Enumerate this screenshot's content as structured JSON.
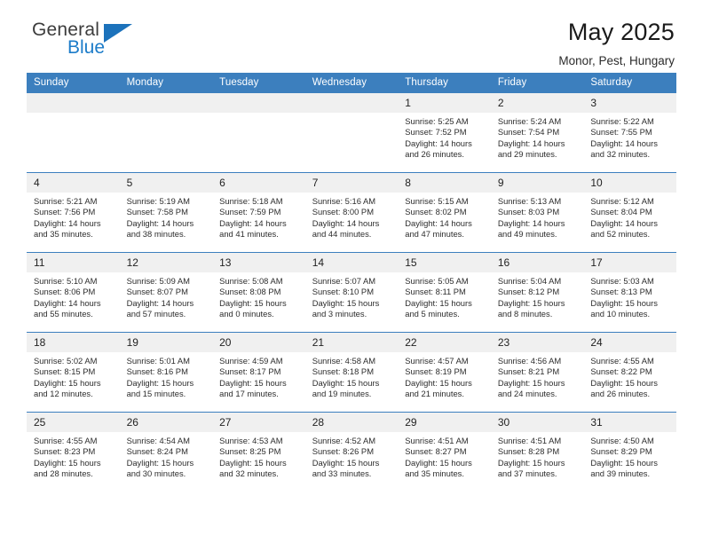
{
  "brand": {
    "line1": "General",
    "line2": "Blue",
    "triangle_icon": "blue-triangle-icon",
    "accent_color": "#1c72bb"
  },
  "header": {
    "title": "May 2025",
    "subtitle": "Monor, Pest, Hungary"
  },
  "theme": {
    "header_row_bg": "#3c7fbe",
    "daynum_bg": "#f0f0f0",
    "grid_line": "#3c7fbe",
    "text": "#2d2d2d"
  },
  "weekdays": [
    "Sunday",
    "Monday",
    "Tuesday",
    "Wednesday",
    "Thursday",
    "Friday",
    "Saturday"
  ],
  "labels": {
    "sunrise": "Sunrise:",
    "sunset": "Sunset:",
    "daylight": "Daylight:"
  },
  "weeks": [
    [
      {
        "day": "",
        "sunrise": "",
        "sunset": "",
        "daylight_l1": "",
        "daylight_l2": ""
      },
      {
        "day": "",
        "sunrise": "",
        "sunset": "",
        "daylight_l1": "",
        "daylight_l2": ""
      },
      {
        "day": "",
        "sunrise": "",
        "sunset": "",
        "daylight_l1": "",
        "daylight_l2": ""
      },
      {
        "day": "",
        "sunrise": "",
        "sunset": "",
        "daylight_l1": "",
        "daylight_l2": ""
      },
      {
        "day": "1",
        "sunrise": "Sunrise: 5:25 AM",
        "sunset": "Sunset: 7:52 PM",
        "daylight_l1": "Daylight: 14 hours",
        "daylight_l2": "and 26 minutes."
      },
      {
        "day": "2",
        "sunrise": "Sunrise: 5:24 AM",
        "sunset": "Sunset: 7:54 PM",
        "daylight_l1": "Daylight: 14 hours",
        "daylight_l2": "and 29 minutes."
      },
      {
        "day": "3",
        "sunrise": "Sunrise: 5:22 AM",
        "sunset": "Sunset: 7:55 PM",
        "daylight_l1": "Daylight: 14 hours",
        "daylight_l2": "and 32 minutes."
      }
    ],
    [
      {
        "day": "4",
        "sunrise": "Sunrise: 5:21 AM",
        "sunset": "Sunset: 7:56 PM",
        "daylight_l1": "Daylight: 14 hours",
        "daylight_l2": "and 35 minutes."
      },
      {
        "day": "5",
        "sunrise": "Sunrise: 5:19 AM",
        "sunset": "Sunset: 7:58 PM",
        "daylight_l1": "Daylight: 14 hours",
        "daylight_l2": "and 38 minutes."
      },
      {
        "day": "6",
        "sunrise": "Sunrise: 5:18 AM",
        "sunset": "Sunset: 7:59 PM",
        "daylight_l1": "Daylight: 14 hours",
        "daylight_l2": "and 41 minutes."
      },
      {
        "day": "7",
        "sunrise": "Sunrise: 5:16 AM",
        "sunset": "Sunset: 8:00 PM",
        "daylight_l1": "Daylight: 14 hours",
        "daylight_l2": "and 44 minutes."
      },
      {
        "day": "8",
        "sunrise": "Sunrise: 5:15 AM",
        "sunset": "Sunset: 8:02 PM",
        "daylight_l1": "Daylight: 14 hours",
        "daylight_l2": "and 47 minutes."
      },
      {
        "day": "9",
        "sunrise": "Sunrise: 5:13 AM",
        "sunset": "Sunset: 8:03 PM",
        "daylight_l1": "Daylight: 14 hours",
        "daylight_l2": "and 49 minutes."
      },
      {
        "day": "10",
        "sunrise": "Sunrise: 5:12 AM",
        "sunset": "Sunset: 8:04 PM",
        "daylight_l1": "Daylight: 14 hours",
        "daylight_l2": "and 52 minutes."
      }
    ],
    [
      {
        "day": "11",
        "sunrise": "Sunrise: 5:10 AM",
        "sunset": "Sunset: 8:06 PM",
        "daylight_l1": "Daylight: 14 hours",
        "daylight_l2": "and 55 minutes."
      },
      {
        "day": "12",
        "sunrise": "Sunrise: 5:09 AM",
        "sunset": "Sunset: 8:07 PM",
        "daylight_l1": "Daylight: 14 hours",
        "daylight_l2": "and 57 minutes."
      },
      {
        "day": "13",
        "sunrise": "Sunrise: 5:08 AM",
        "sunset": "Sunset: 8:08 PM",
        "daylight_l1": "Daylight: 15 hours",
        "daylight_l2": "and 0 minutes."
      },
      {
        "day": "14",
        "sunrise": "Sunrise: 5:07 AM",
        "sunset": "Sunset: 8:10 PM",
        "daylight_l1": "Daylight: 15 hours",
        "daylight_l2": "and 3 minutes."
      },
      {
        "day": "15",
        "sunrise": "Sunrise: 5:05 AM",
        "sunset": "Sunset: 8:11 PM",
        "daylight_l1": "Daylight: 15 hours",
        "daylight_l2": "and 5 minutes."
      },
      {
        "day": "16",
        "sunrise": "Sunrise: 5:04 AM",
        "sunset": "Sunset: 8:12 PM",
        "daylight_l1": "Daylight: 15 hours",
        "daylight_l2": "and 8 minutes."
      },
      {
        "day": "17",
        "sunrise": "Sunrise: 5:03 AM",
        "sunset": "Sunset: 8:13 PM",
        "daylight_l1": "Daylight: 15 hours",
        "daylight_l2": "and 10 minutes."
      }
    ],
    [
      {
        "day": "18",
        "sunrise": "Sunrise: 5:02 AM",
        "sunset": "Sunset: 8:15 PM",
        "daylight_l1": "Daylight: 15 hours",
        "daylight_l2": "and 12 minutes."
      },
      {
        "day": "19",
        "sunrise": "Sunrise: 5:01 AM",
        "sunset": "Sunset: 8:16 PM",
        "daylight_l1": "Daylight: 15 hours",
        "daylight_l2": "and 15 minutes."
      },
      {
        "day": "20",
        "sunrise": "Sunrise: 4:59 AM",
        "sunset": "Sunset: 8:17 PM",
        "daylight_l1": "Daylight: 15 hours",
        "daylight_l2": "and 17 minutes."
      },
      {
        "day": "21",
        "sunrise": "Sunrise: 4:58 AM",
        "sunset": "Sunset: 8:18 PM",
        "daylight_l1": "Daylight: 15 hours",
        "daylight_l2": "and 19 minutes."
      },
      {
        "day": "22",
        "sunrise": "Sunrise: 4:57 AM",
        "sunset": "Sunset: 8:19 PM",
        "daylight_l1": "Daylight: 15 hours",
        "daylight_l2": "and 21 minutes."
      },
      {
        "day": "23",
        "sunrise": "Sunrise: 4:56 AM",
        "sunset": "Sunset: 8:21 PM",
        "daylight_l1": "Daylight: 15 hours",
        "daylight_l2": "and 24 minutes."
      },
      {
        "day": "24",
        "sunrise": "Sunrise: 4:55 AM",
        "sunset": "Sunset: 8:22 PM",
        "daylight_l1": "Daylight: 15 hours",
        "daylight_l2": "and 26 minutes."
      }
    ],
    [
      {
        "day": "25",
        "sunrise": "Sunrise: 4:55 AM",
        "sunset": "Sunset: 8:23 PM",
        "daylight_l1": "Daylight: 15 hours",
        "daylight_l2": "and 28 minutes."
      },
      {
        "day": "26",
        "sunrise": "Sunrise: 4:54 AM",
        "sunset": "Sunset: 8:24 PM",
        "daylight_l1": "Daylight: 15 hours",
        "daylight_l2": "and 30 minutes."
      },
      {
        "day": "27",
        "sunrise": "Sunrise: 4:53 AM",
        "sunset": "Sunset: 8:25 PM",
        "daylight_l1": "Daylight: 15 hours",
        "daylight_l2": "and 32 minutes."
      },
      {
        "day": "28",
        "sunrise": "Sunrise: 4:52 AM",
        "sunset": "Sunset: 8:26 PM",
        "daylight_l1": "Daylight: 15 hours",
        "daylight_l2": "and 33 minutes."
      },
      {
        "day": "29",
        "sunrise": "Sunrise: 4:51 AM",
        "sunset": "Sunset: 8:27 PM",
        "daylight_l1": "Daylight: 15 hours",
        "daylight_l2": "and 35 minutes."
      },
      {
        "day": "30",
        "sunrise": "Sunrise: 4:51 AM",
        "sunset": "Sunset: 8:28 PM",
        "daylight_l1": "Daylight: 15 hours",
        "daylight_l2": "and 37 minutes."
      },
      {
        "day": "31",
        "sunrise": "Sunrise: 4:50 AM",
        "sunset": "Sunset: 8:29 PM",
        "daylight_l1": "Daylight: 15 hours",
        "daylight_l2": "and 39 minutes."
      }
    ]
  ]
}
